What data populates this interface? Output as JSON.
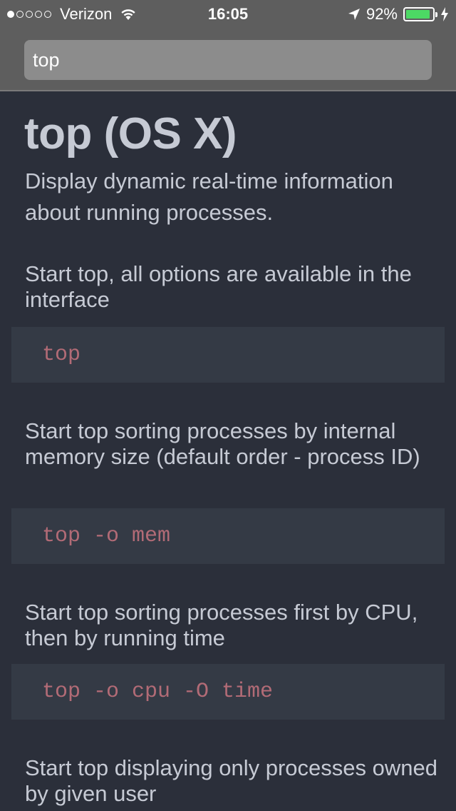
{
  "status_bar": {
    "carrier": "Verizon",
    "time": "16:05",
    "battery_percent": "92%",
    "battery_level": 0.92,
    "signal_bars_filled": 1,
    "signal_bars_total": 5,
    "battery_color": "#4cd964",
    "icons": [
      "wifi-icon",
      "location-arrow-icon",
      "battery-icon",
      "charging-icon"
    ]
  },
  "search": {
    "value": "top"
  },
  "page": {
    "title": "top (OS X)",
    "description": "Display dynamic real-time information about running processes."
  },
  "examples": [
    {
      "description": "Start top, all options are available in the interface",
      "command": "top"
    },
    {
      "description": "Start top sorting processes by internal memory size (default order - process ID)",
      "command": "top -o mem"
    },
    {
      "description": "Start top sorting processes first by CPU, then by running time",
      "command": "top -o cpu -O time"
    },
    {
      "description": "Start top displaying only processes owned by given user"
    }
  ],
  "colors": {
    "background": "#2b2f3a",
    "code_background": "#343a45",
    "code_text": "#b26b76",
    "text": "#c6cad4",
    "header": "#5e5e5e"
  }
}
